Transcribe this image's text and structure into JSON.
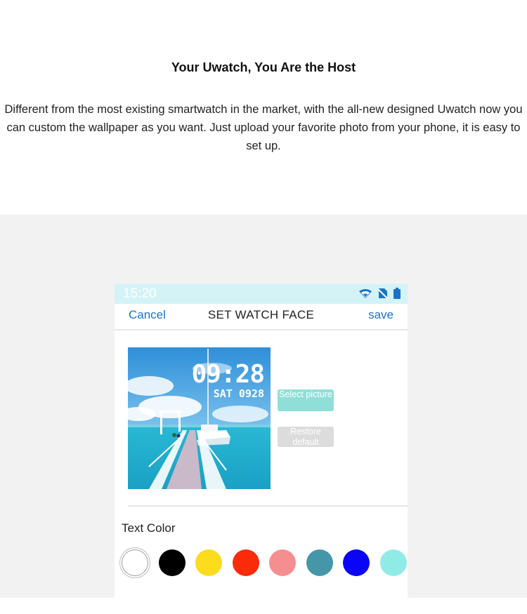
{
  "header": {
    "headline": "Your Uwatch, You Are the Host",
    "description": "Different from the most existing smartwatch in the market, with the all-new designed Uwatch now you can custom the wallpaper as you want. Just upload your favorite photo from your phone, it is easy to set up."
  },
  "phone": {
    "status_bar": {
      "time": "15:20",
      "icons": [
        "wifi-icon",
        "no-sim-icon",
        "battery-icon"
      ],
      "background": "#d3f3f7"
    },
    "nav": {
      "cancel_label": "Cancel",
      "title": "SET WATCH FACE",
      "save_label": "save",
      "link_color": "#1a73c9"
    },
    "watch_preview": {
      "time": "09:28",
      "date": "SAT 0928"
    },
    "buttons": {
      "select_picture": "Select picture",
      "restore_default": "Restore default"
    },
    "text_color": {
      "label": "Text Color",
      "swatches": [
        {
          "name": "white",
          "color": "#ffffff"
        },
        {
          "name": "black",
          "color": "#000000"
        },
        {
          "name": "yellow",
          "color": "#fcdc1c"
        },
        {
          "name": "red",
          "color": "#fa2a0a"
        },
        {
          "name": "pink",
          "color": "#f58e90"
        },
        {
          "name": "teal",
          "color": "#4497a8"
        },
        {
          "name": "blue",
          "color": "#0a05f8"
        },
        {
          "name": "aqua",
          "color": "#90ebe6"
        }
      ]
    }
  }
}
